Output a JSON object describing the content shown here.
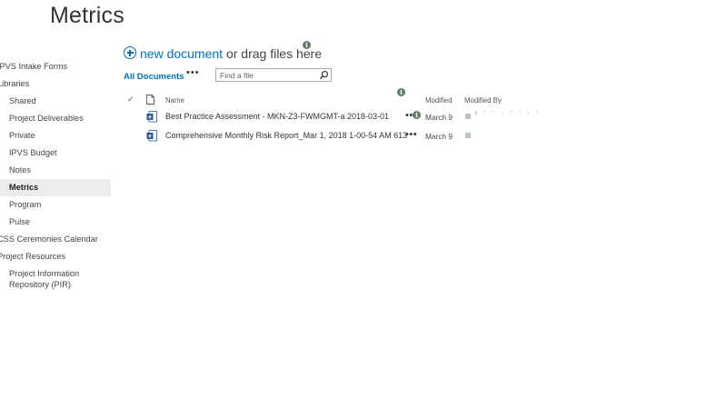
{
  "page": {
    "title": "Metrics"
  },
  "leftnav": {
    "items": [
      {
        "label": "IPVS Intake Forms",
        "level": 0,
        "selected": false
      },
      {
        "label": "Libraries",
        "level": 0,
        "selected": false
      },
      {
        "label": "Shared",
        "level": 1,
        "selected": false
      },
      {
        "label": "Project Deliverables",
        "level": 1,
        "selected": false
      },
      {
        "label": "Private",
        "level": 1,
        "selected": false
      },
      {
        "label": "IPVS Budget",
        "level": 1,
        "selected": false
      },
      {
        "label": "Notes",
        "level": 1,
        "selected": false
      },
      {
        "label": "Metrics",
        "level": 1,
        "selected": true
      },
      {
        "label": "Program",
        "level": 1,
        "selected": false
      },
      {
        "label": "Pulse",
        "level": 1,
        "selected": false
      },
      {
        "label": "CSS Ceremonies Calendar",
        "level": 0,
        "selected": false
      },
      {
        "label": "Project Resources",
        "level": 0,
        "selected": false
      },
      {
        "label": "Project Information Repository (PIR)",
        "level": 1,
        "selected": false
      }
    ]
  },
  "toolbar": {
    "new_document_label": "new document",
    "drag_label": " or drag files here",
    "view_label": "All Documents",
    "more_label": "•••",
    "search_placeholder": "Find a file"
  },
  "columns": {
    "name": "Name",
    "modified": "Modified",
    "modified_by": "Modified By"
  },
  "files": [
    {
      "name": "Best Practice Assessment - MKN-Z3-FWMGMT-a 2018-03-01",
      "modified": "March 9",
      "more": "•••",
      "has_info": true,
      "modified_by": "I  '      ' - ' ' - '"
    },
    {
      "name": "Comprehensive Monthly Risk Report_Mar 1, 2018 1-00-54 AM 613",
      "modified": "March 9",
      "more": "•••",
      "has_info": false,
      "modified_by": ""
    }
  ],
  "icons": {
    "info": "info-icon",
    "file": "word-document-icon",
    "search": "search-icon",
    "add": "plus-circle-icon"
  },
  "colors": {
    "accent": "#0072c6",
    "info": "#5e7d63",
    "selected_bg": "#ececec"
  }
}
